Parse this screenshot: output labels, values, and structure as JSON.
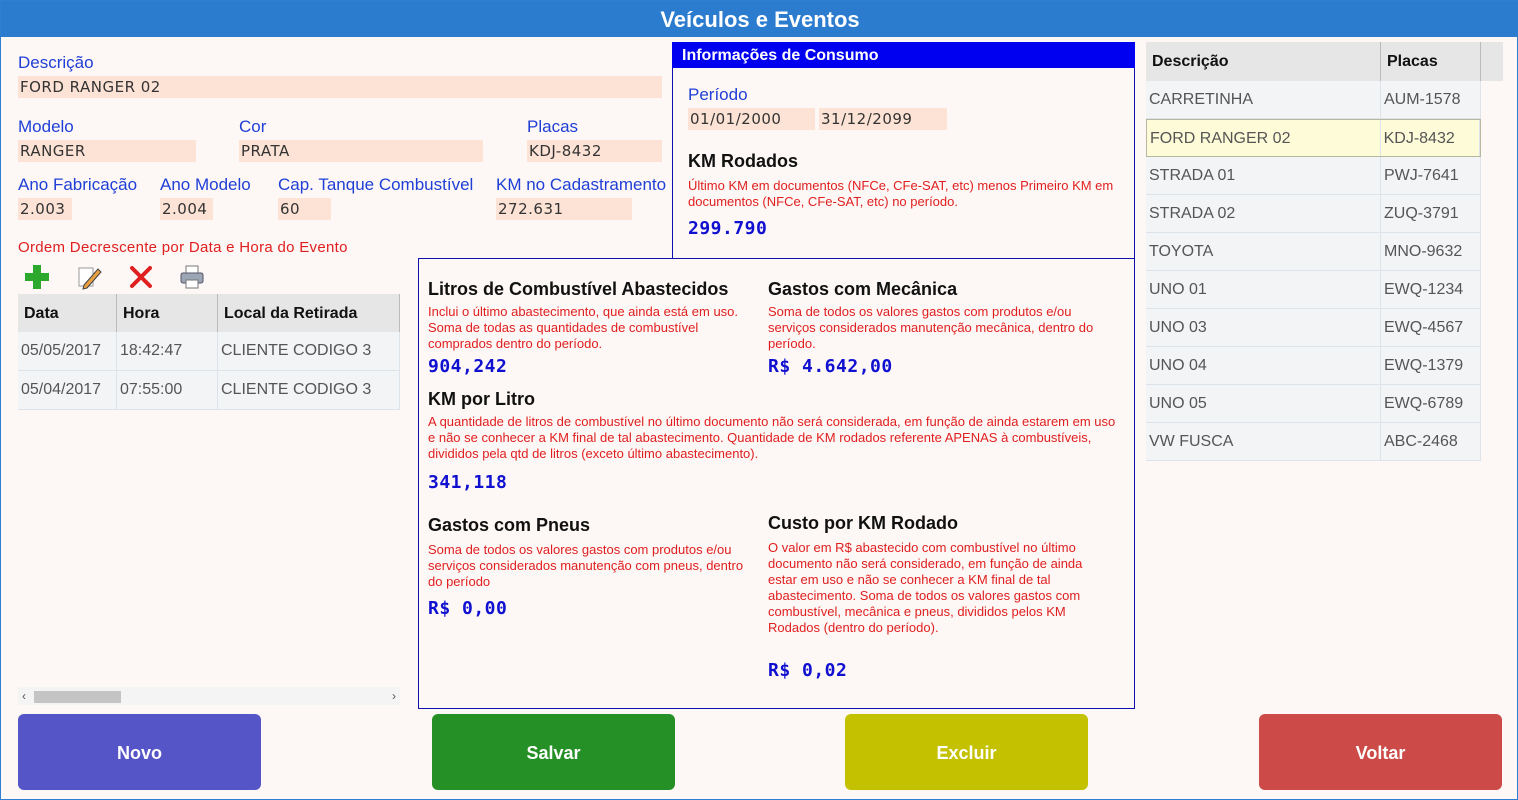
{
  "window": {
    "title": "Veículos e Eventos"
  },
  "form": {
    "descricao_label": "Descrição",
    "descricao_value": "FORD RANGER 02",
    "modelo_label": "Modelo",
    "modelo_value": "RANGER",
    "cor_label": "Cor",
    "cor_value": "PRATA",
    "placas_label": "Placas",
    "placas_value": "KDJ-8432",
    "ano_fab_label": "Ano Fabricação",
    "ano_fab_value": "2.003",
    "ano_modelo_label": "Ano Modelo",
    "ano_modelo_value": "2.004",
    "cap_tanque_label": "Cap. Tanque Combustível",
    "cap_tanque_value": "60",
    "km_cad_label": "KM no Cadastramento",
    "km_cad_value": "272.631"
  },
  "events": {
    "order_label": "Ordem Decrescente por Data e Hora do Evento",
    "toolbar": [
      "add-icon",
      "edit-icon",
      "delete-icon",
      "print-icon"
    ],
    "headers": [
      "Data",
      "Hora",
      "Local da Retirada"
    ],
    "rows": [
      [
        "05/05/2017",
        "18:42:47",
        "CLIENTE CODIGO 3"
      ],
      [
        "05/04/2017",
        "07:55:00",
        "CLIENTE CODIGO 3"
      ]
    ],
    "scroll_left": "‹",
    "scroll_right": "›"
  },
  "consumo": {
    "title": "Informações de Consumo",
    "periodo_label": "Período",
    "periodo_inicio": "01/01/2000",
    "periodo_fim": "31/12/2099",
    "km_rodados_title": "KM Rodados",
    "km_rodados_desc": "Último KM em documentos (NFCe, CFe-SAT, etc) menos Primeiro KM em documentos (NFCe, CFe-SAT, etc) no período.",
    "km_rodados_value": "299.790",
    "litros_title": "Litros de Combustível Abastecidos",
    "litros_desc": "Inclui o último abastecimento, que ainda está em uso. Soma de todas as quantidades de combustível comprados dentro do período.",
    "litros_value": "904,242",
    "mecanica_title": "Gastos com Mecânica",
    "mecanica_desc": "Soma de todos os valores gastos com produtos e/ou serviços considerados manutenção mecânica, dentro do período.",
    "mecanica_value": "R$ 4.642,00",
    "km_litro_title": "KM por Litro",
    "km_litro_desc": "A quantidade de litros de combustível no último documento não será considerada, em função de ainda estarem em uso e não se conhecer a KM final de tal abastecimento. Quantidade de KM rodados referente APENAS à combustíveis, divididos pela qtd de litros (exceto último abastecimento).",
    "km_litro_value": "341,118",
    "pneus_title": "Gastos com Pneus",
    "pneus_desc": "Soma de todos os valores gastos com produtos e/ou serviços considerados manutenção com pneus, dentro do período",
    "pneus_value": "R$ 0,00",
    "custo_title": "Custo por KM Rodado",
    "custo_desc": "O valor em R$  abastecido com combustível no último documento não será considerado, em função de ainda estar em uso e não se conhecer a KM final de tal abastecimento. Soma de todos os valores gastos com combustível, mecânica e pneus, divididos pelos KM Rodados (dentro do período).",
    "custo_value": "R$ 0,02"
  },
  "vehicles": {
    "headers": [
      "Descrição",
      "Placas"
    ],
    "rows": [
      [
        "CARRETINHA",
        "AUM-1578"
      ],
      [
        "FORD RANGER 02",
        "KDJ-8432"
      ],
      [
        "STRADA 01",
        "PWJ-7641"
      ],
      [
        "STRADA 02",
        "ZUQ-3791"
      ],
      [
        "TOYOTA",
        "MNO-9632"
      ],
      [
        "UNO 01",
        "EWQ-1234"
      ],
      [
        "UNO 03",
        "EWQ-4567"
      ],
      [
        "UNO 04",
        "EWQ-1379"
      ],
      [
        "UNO 05",
        "EWQ-6789"
      ],
      [
        "VW FUSCA",
        "ABC-2468"
      ]
    ],
    "selected_index": 1
  },
  "buttons": {
    "novo": "Novo",
    "salvar": "Salvar",
    "excluir": "Excluir",
    "voltar": "Voltar"
  },
  "colors": {
    "title_bar": "#2b7bcf",
    "novo": "#5555c8",
    "salvar": "#259025",
    "excluir": "#c4c200",
    "voltar": "#cc4a48"
  }
}
